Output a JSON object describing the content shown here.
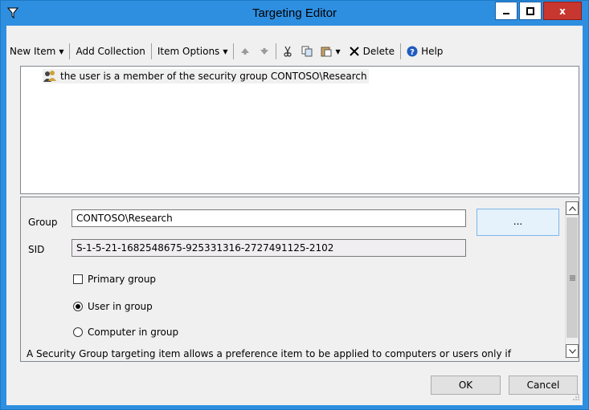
{
  "window": {
    "title": "Targeting Editor",
    "close_glyph": "x",
    "accent": "#2e8fe1",
    "close_color": "#c7372f"
  },
  "toolbar": {
    "new_item": "New Item",
    "add_collection": "Add Collection",
    "item_options": "Item Options",
    "delete": "Delete",
    "help": "Help",
    "icons": [
      "filter-icon",
      "move-up-icon",
      "move-down-icon",
      "cut-icon",
      "copy-icon",
      "paste-icon",
      "delete-icon",
      "help-icon"
    ]
  },
  "tree": {
    "items": [
      {
        "label": "the user is a member of the security group CONTOSO\\Research",
        "icon": "security-group-icon"
      }
    ]
  },
  "properties": {
    "group_label": "Group",
    "group_value": "CONTOSO\\Research",
    "browse_label": "...",
    "sid_label": "SID",
    "sid_value": "S-1-5-21-1682548675-925331316-2727491125-2102",
    "primary_group_label": "Primary group",
    "primary_group_checked": false,
    "user_in_group_label": "User in group",
    "user_in_group_selected": true,
    "computer_in_group_label": "Computer in group",
    "computer_in_group_selected": false,
    "description": "A Security Group targeting item allows a preference item to be applied to computers or users only if"
  },
  "buttons": {
    "ok": "OK",
    "cancel": "Cancel"
  }
}
